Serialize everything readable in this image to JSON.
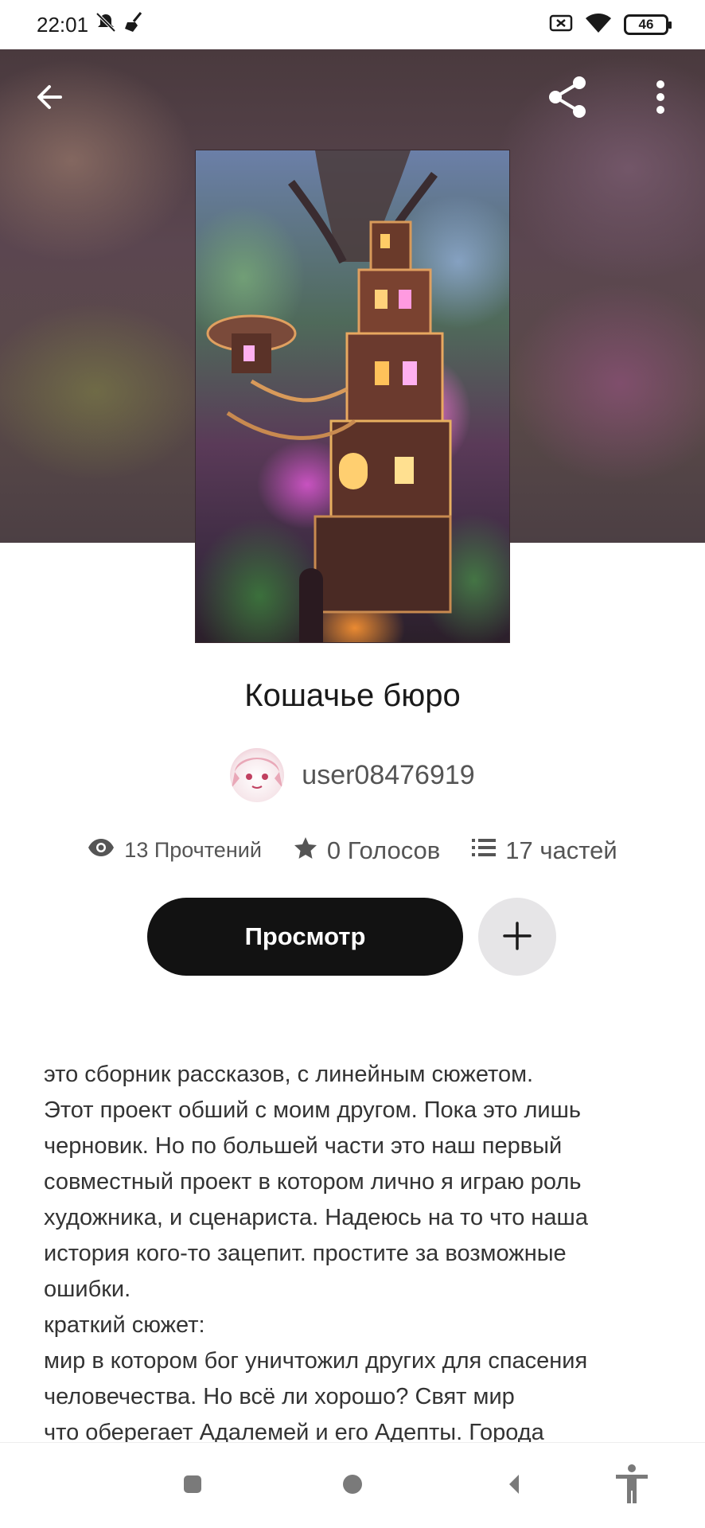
{
  "status_bar": {
    "time": "22:01",
    "battery": "46",
    "icons": [
      "notifications-off-icon",
      "broom-icon",
      "sim-off-icon",
      "wifi-icon",
      "battery-icon"
    ]
  },
  "header": {
    "back_icon": "arrow-left-icon",
    "share_icon": "share-icon",
    "menu_icon": "more-vertical-icon"
  },
  "story": {
    "title": "Кошачье бюро",
    "author": "user08476919"
  },
  "stats": {
    "reads": "13 Прочтений",
    "votes": "0 Голосов",
    "parts": "17 частей"
  },
  "actions": {
    "read_label": "Просмотр",
    "add_icon": "plus-icon"
  },
  "description": {
    "lines": [
      "это сборник рассказов, с линейным сюжетом.",
      "Этот проект обший с моим другом. Пока это лишь",
      "черновик. Но по большей части это наш первый",
      "совместный проект в котором лично я играю роль",
      "художника, и сценариста. Надеюсь на то что наша",
      "история кого-то зацепит. простите за возможные",
      "ошибки.",
      "краткий сюжет:",
      "мир в котором бог уничтожил других для спасения",
      "человечества. Но всё ли хорошо? Свят мир",
      "что оберегает Адалемей и его Адепты. Города"
    ]
  },
  "nav_bar": {
    "icons": [
      "recents-icon",
      "home-icon",
      "back-icon",
      "accessibility-icon"
    ]
  },
  "colors": {
    "primary_button": "#121212",
    "secondary_button": "#e6e5e7",
    "text_primary": "#1a1a1a",
    "text_secondary": "#555555"
  }
}
